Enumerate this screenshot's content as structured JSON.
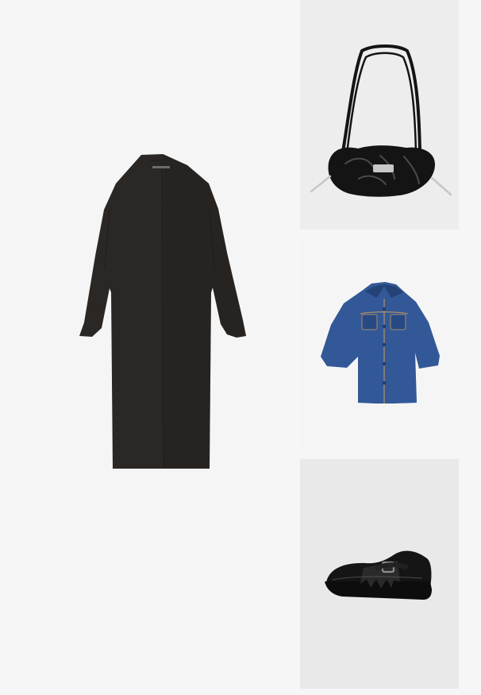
{
  "board": {
    "items": [
      {
        "name": "knit-dress",
        "colors": {
          "main": "#2a2725",
          "shade": "#1f1c1b"
        }
      },
      {
        "name": "shoulder-bag",
        "colors": {
          "main": "#141414",
          "hardware": "#c7c7c7"
        }
      },
      {
        "name": "denim-jacket",
        "colors": {
          "main": "#2b4f8f",
          "light": "#4a74b3",
          "button": "#223c6f"
        }
      },
      {
        "name": "loafer",
        "colors": {
          "main": "#151515",
          "sole": "#0d0d0d",
          "buckle": "#8d8d8d"
        }
      }
    ]
  }
}
